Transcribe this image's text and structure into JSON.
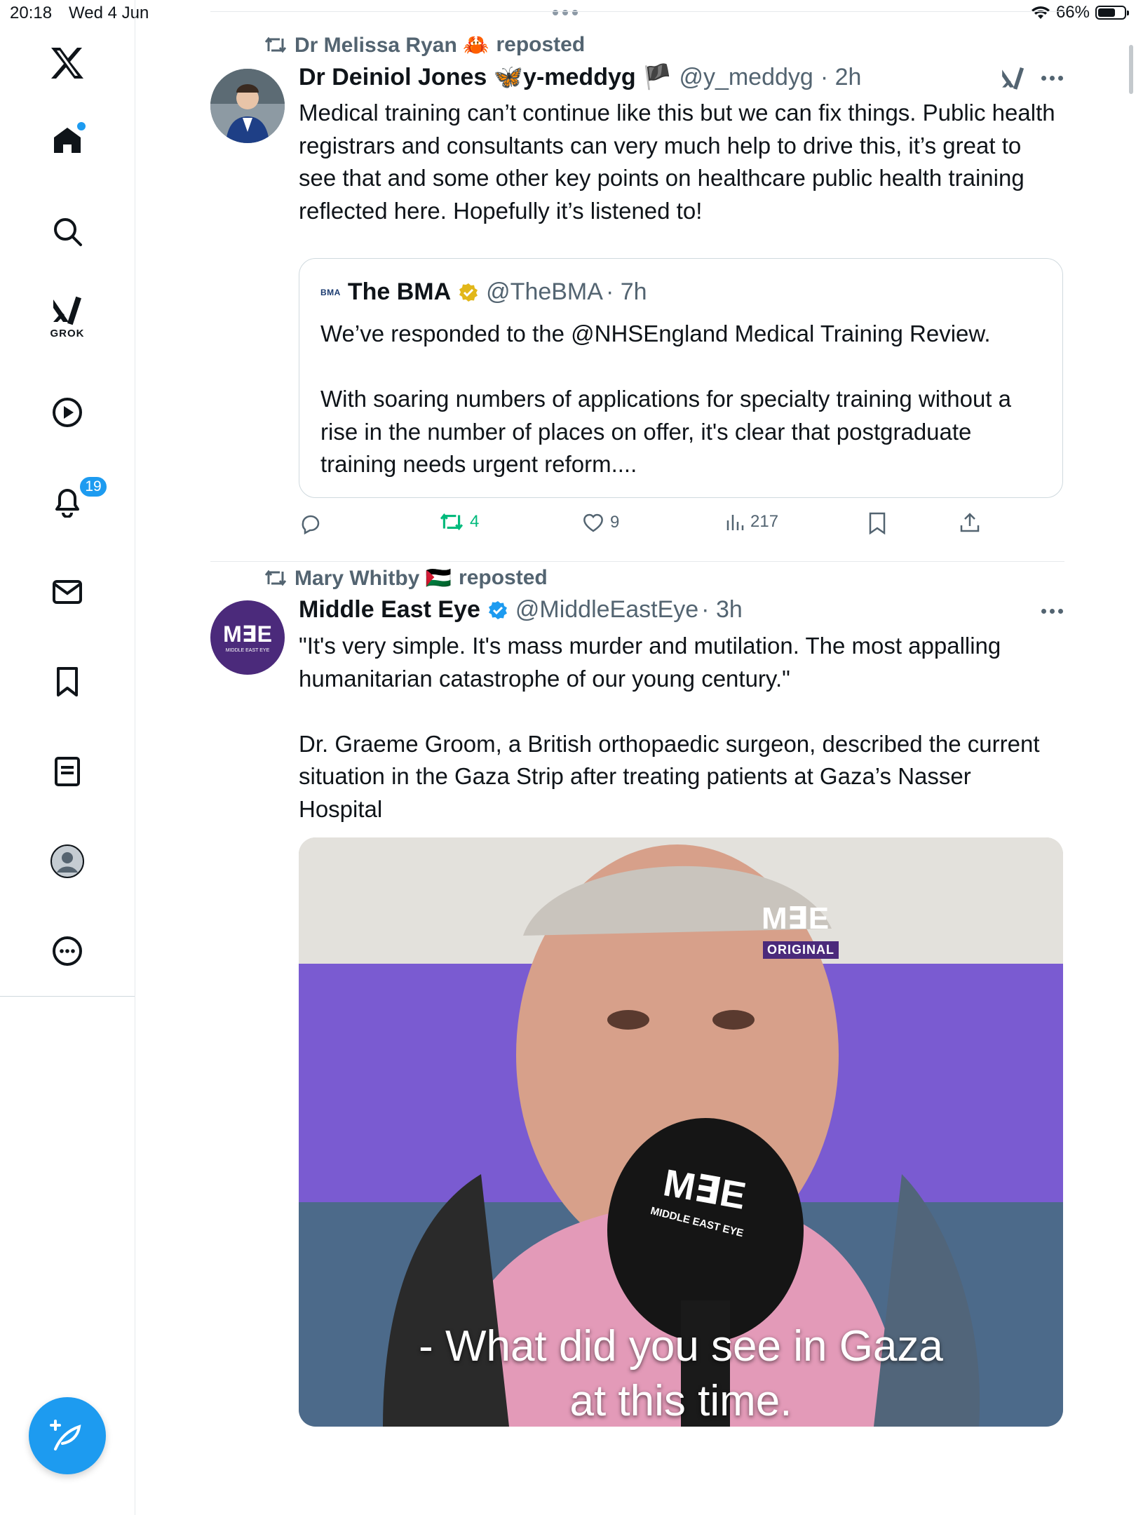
{
  "status_bar": {
    "time": "20:18",
    "date": "Wed 4 Jun",
    "battery_text": "66%",
    "battery_level": 0.66
  },
  "sidebar": {
    "grok_label": "GROK",
    "notifications_badge": "19"
  },
  "posts": [
    {
      "reposted_by": "Dr Melissa Ryan 🦀",
      "reposted_label": "reposted",
      "author_name": "Dr Deiniol Jones 🦋y-meddyg 🏴",
      "handle": "@y_meddyg",
      "time": "· 2h",
      "text": "Medical training can’t continue like this but we can fix things. Public health registrars and consultants can very much help to drive this, it’s great to see that and some other key points on healthcare public health training reflected here. Hopefully it’s listened to!",
      "quote": {
        "logo": "BMA",
        "name": "The BMA",
        "handle": "@TheBMA",
        "time": "· 7h",
        "text": "We’ve responded to the @NHSEngland Medical Training Review.\n\nWith soaring numbers of applications for specialty training without a rise in the number of places on offer, it's clear that postgraduate training needs urgent reform...."
      },
      "actions": {
        "replies": "",
        "reposts": "4",
        "likes": "9",
        "views": "217"
      }
    },
    {
      "reposted_by": "Mary Whitby 🇵🇸",
      "reposted_label": "reposted",
      "author_name": "Middle East Eye",
      "handle": "@MiddleEastEye",
      "time": "· 3h",
      "avatar_text": "M∃E",
      "avatar_sub": "MIDDLE EAST EYE",
      "text": "\"It's very simple. It's mass murder and mutilation. The most appalling humanitarian catastrophe of our young century.\"\n\nDr. Graeme Groom, a British orthopaedic surgeon, described the current situation in the Gaza Strip after treating patients at Gaza’s Nasser Hospital",
      "media": {
        "corner_logo": "M∃E",
        "corner_label": "ORIGINAL",
        "mic_logo": "M∃E",
        "mic_label": "MIDDLE EAST EYE",
        "caption_line1": "- What did you see in Gaza",
        "caption_line2": "at this time."
      }
    }
  ],
  "colors": {
    "accent": "#1d9bf0",
    "repost_green": "#00ba7c",
    "secondary_text": "#536471",
    "mee_purple": "#4b2a7b"
  }
}
